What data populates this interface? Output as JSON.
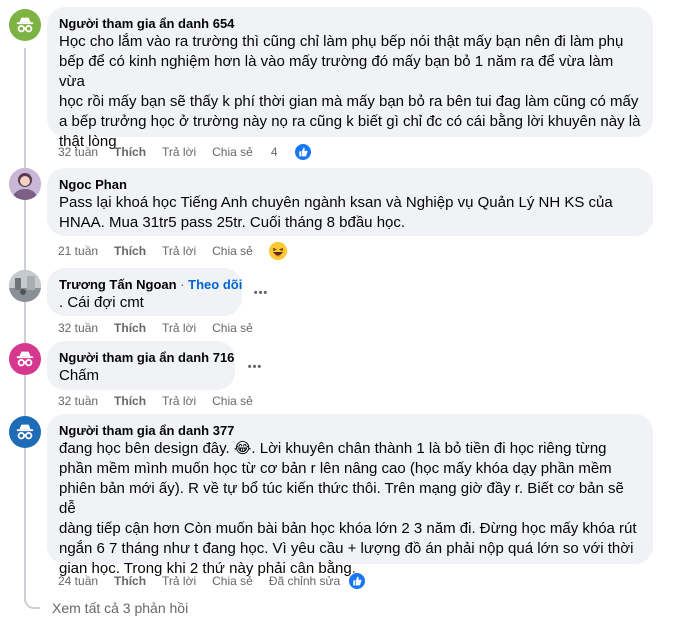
{
  "comments": [
    {
      "author": "Người tham gia ẩn danh 654",
      "avatar_icon": "anonymous-incognito-icon",
      "avatar_color": "#7cb342",
      "lines": [
        "Học cho lắm vào ra trường thì cũng chỉ làm phụ bếp nói thật mấy bạn nên đi làm phụ",
        "bếp để có kinh nghiệm hơn là vào mấy trường đó mấy bạn bỏ 1 năm ra để vừa làm vừa",
        "học rồi mấy bạn sẽ thấy k phí thời gian mà mấy bạn bỏ ra bên tui đag làm cũng có mấy",
        "a bếp trưởng học ở trường này nọ ra cũng k biết gì chỉ đc có cái bằng lời khuyên này là",
        "thật lòng"
      ],
      "time": "32 tuần",
      "like": "Thích",
      "reply": "Trả lời",
      "share": "Chia sẻ",
      "reaction_count": "4",
      "reaction_icon": "like-reaction-icon"
    },
    {
      "author": "Ngoc Phan",
      "avatar_icon": "profile-photo",
      "lines": [
        "Pass lại khoá học Tiếng Anh chuyên ngành ksan và Nghiệp vụ Quản Lý NH KS của",
        "HNAA. Mua 31tr5 pass 25tr. Cuối tháng 8 bđầu học."
      ],
      "time": "21 tuần",
      "like": "Thích",
      "reply": "Trả lời",
      "share": "Chia sẻ",
      "reaction_icon": "haha-reaction-icon"
    },
    {
      "author": "Trương Tấn Ngoan",
      "separator": " · ",
      "follow": "Theo dõi",
      "avatar_icon": "profile-photo",
      "lines": [
        ". Cái đợi cmt"
      ],
      "time": "32 tuần",
      "like": "Thích",
      "reply": "Trả lời",
      "share": "Chia sẻ",
      "more": "•••"
    },
    {
      "author": "Người tham gia ẩn danh 716",
      "avatar_icon": "anonymous-incognito-icon",
      "avatar_color": "#d6388f",
      "lines": [
        "Chấm"
      ],
      "time": "32 tuần",
      "like": "Thích",
      "reply": "Trả lời",
      "share": "Chia sẻ",
      "more": "•••"
    },
    {
      "author": "Người tham gia ẩn danh 377",
      "avatar_icon": "anonymous-incognito-icon",
      "avatar_color": "#1e6bb8",
      "lines": [
        "đang học bên design đây. 😂. Lời khuyên chân thành 1 là bỏ tiền đi học riêng từng",
        "phần mềm mình muốn học từ cơ bản r lên nâng cao (học mấy khóa dạy phần mềm",
        "phiên bản mới ấy). R về tự bổ túc kiến thức thôi. Trên mạng giờ đầy r. Biết cơ bản sẽ dễ",
        "dàng tiếp cận hơn Còn muốn bài bản học khóa lớn 2 3 năm đi. Đừng học mấy khóa rút",
        "ngắn 6 7 tháng như t đang học. Vì yêu cầu + lượng đồ án phải nộp quá lớn so với thời",
        "gian học. Trong khi 2 thứ này phải cân bằng."
      ],
      "time": "24 tuần",
      "like": "Thích",
      "reply": "Trả lời",
      "share": "Chia sẻ",
      "edited": "Đã chỉnh sửa",
      "reaction_icon": "like-reaction-icon"
    }
  ],
  "see_all_replies": "Xem tất cả 3 phản hồi"
}
